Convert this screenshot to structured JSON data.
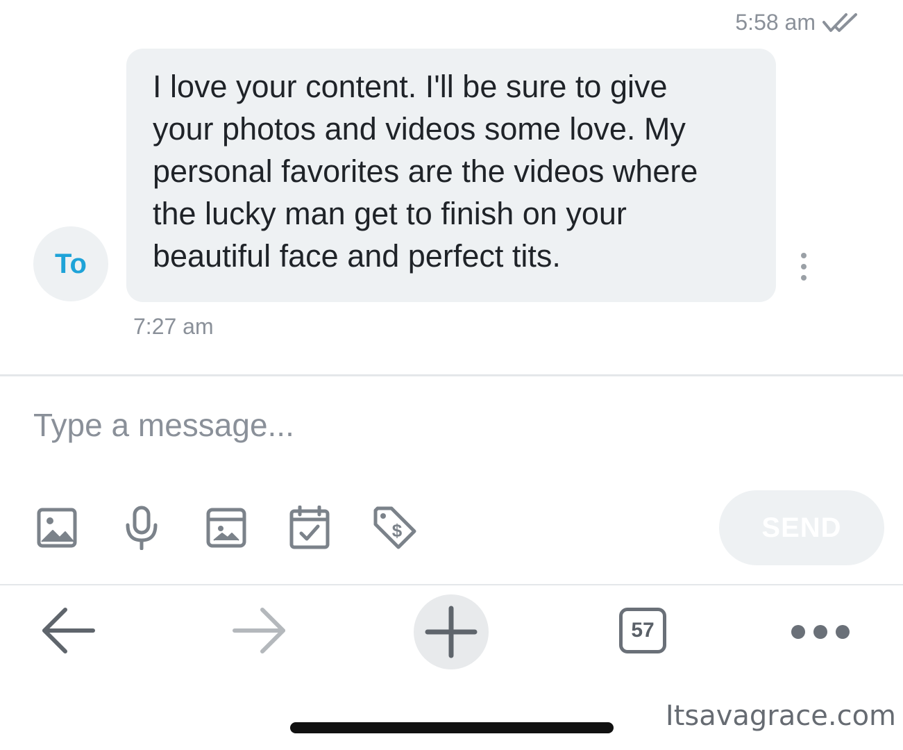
{
  "header": {
    "previous_time": "5:58 am",
    "read_status_icon": "double-check-icon"
  },
  "message": {
    "avatar_initials": "To",
    "text": "I love your content. I'll be sure to give\nyour photos and videos some love. My\npersonal favorites are the videos where\nthe lucky man get to finish on your\nbeautiful face and perfect tits.",
    "time": "7:27 am",
    "menu_icon": "vertical-dots-icon"
  },
  "composer": {
    "placeholder": "Type a message...",
    "value": "",
    "tools": [
      "image-icon",
      "microphone-icon",
      "media-vault-icon",
      "calendar-check-icon",
      "price-tag-icon"
    ],
    "send_label": "SEND"
  },
  "browser_nav": {
    "back_icon": "arrow-left-icon",
    "forward_icon": "arrow-right-icon",
    "new_tab_icon": "plus-icon",
    "tab_count": "57",
    "more_icon": "more-dots-icon"
  },
  "watermark": "Itsavagrace.com",
  "colors": {
    "bubble": "#eef1f3",
    "avatar_text": "#1ea3d8",
    "muted_text": "#8a9099",
    "icon_gray": "#6a7078"
  }
}
